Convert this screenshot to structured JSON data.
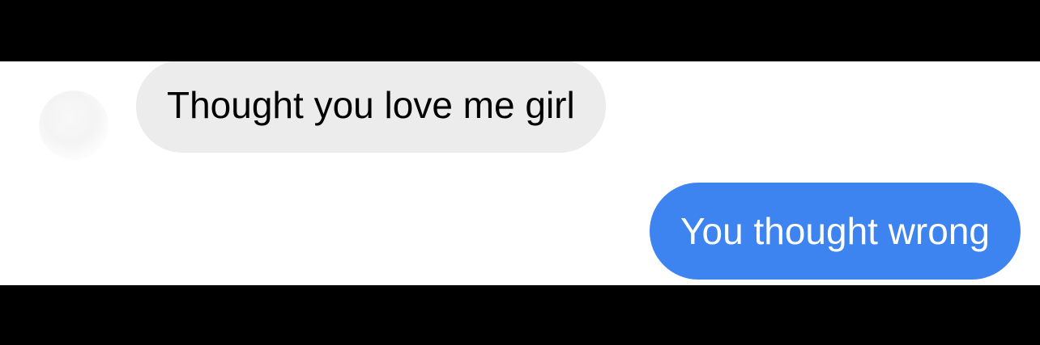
{
  "conversation": {
    "messages": [
      {
        "sender": "other",
        "text": "Thought you love me girl"
      },
      {
        "sender": "me",
        "text": "You thought wrong"
      }
    ]
  },
  "colors": {
    "received_bubble": "#ececec",
    "sent_bubble": "#3d84f0",
    "background": "#ffffff",
    "letterbox": "#000000"
  },
  "icons": {
    "avatar": "contact-avatar-icon"
  }
}
